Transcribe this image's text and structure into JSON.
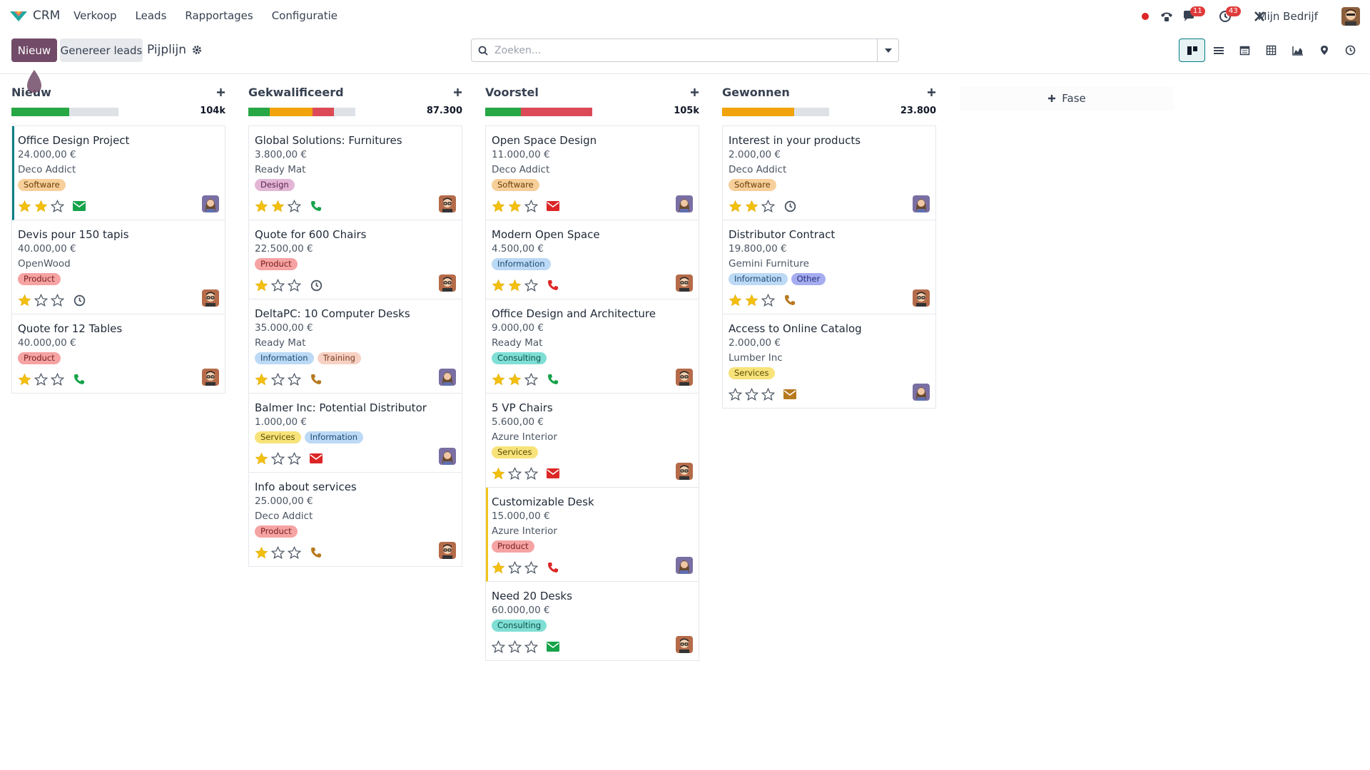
{
  "nav": {
    "app_name": "CRM",
    "menu": [
      "Verkoop",
      "Leads",
      "Rapportages",
      "Configuratie"
    ],
    "messages_badge": "11",
    "activities_badge": "43",
    "company": "Mijn Bedrijf"
  },
  "control": {
    "new_label": "Nieuw",
    "generate_label": "Genereer leads",
    "breadcrumb": "Pijplijn",
    "search_placeholder": "Zoeken...",
    "views": [
      "kanban",
      "list",
      "calendar",
      "pivot",
      "graph",
      "map",
      "activity"
    ],
    "active_view": "kanban"
  },
  "add_stage_label": "Fase",
  "colors": {
    "primary": "#714b67",
    "green": "#28a745",
    "orange": "#f0a30a",
    "red": "#dc4a58",
    "grey": "#dee2e6",
    "teal": "#017e84"
  },
  "columns": [
    {
      "title": "Nieuw",
      "total": "104k",
      "progress": [
        {
          "color": "#28a745",
          "pct": 54
        },
        {
          "color": "#dee2e6",
          "pct": 46
        }
      ],
      "cards": [
        {
          "title": "Office Design Project",
          "amount": "24.000,00 €",
          "company": "Deco Addict",
          "tags": [
            {
              "label": "Software",
              "bg": "#f7cf9a",
              "fg": "#6b3d06"
            }
          ],
          "stars": 2,
          "activity": "email",
          "activity_color": "#16a34a",
          "avatar": "woman",
          "highlight": "#017e84"
        },
        {
          "title": "Devis pour 150 tapis",
          "amount": "40.000,00 €",
          "company": "OpenWood",
          "tags": [
            {
              "label": "Product",
              "bg": "#f5a3a3",
              "fg": "#7a1f1f"
            }
          ],
          "stars": 1,
          "activity": "clock",
          "activity_color": "#4b5563",
          "avatar": "man"
        },
        {
          "title": "Quote for 12 Tables",
          "amount": "40.000,00 €",
          "company": "",
          "tags": [
            {
              "label": "Product",
              "bg": "#f5a3a3",
              "fg": "#7a1f1f"
            }
          ],
          "stars": 1,
          "activity": "phone",
          "activity_color": "#16a34a",
          "avatar": "man"
        }
      ]
    },
    {
      "title": "Gekwalificeerd",
      "total": "87.300",
      "progress": [
        {
          "color": "#28a745",
          "pct": 20
        },
        {
          "color": "#f0a30a",
          "pct": 40
        },
        {
          "color": "#dc4a58",
          "pct": 20
        },
        {
          "color": "#dee2e6",
          "pct": 20
        }
      ],
      "cards": [
        {
          "title": "Global Solutions: Furnitures",
          "amount": "3.800,00 €",
          "company": "Ready Mat",
          "tags": [
            {
              "label": "Design",
              "bg": "#e3b6d6",
              "fg": "#5a2450"
            }
          ],
          "stars": 2,
          "activity": "phone",
          "activity_color": "#16a34a",
          "avatar": "man"
        },
        {
          "title": "Quote for 600 Chairs",
          "amount": "22.500,00 €",
          "company": "",
          "tags": [
            {
              "label": "Product",
              "bg": "#f5a3a3",
              "fg": "#7a1f1f"
            }
          ],
          "stars": 1,
          "activity": "clock",
          "activity_color": "#4b5563",
          "avatar": "man"
        },
        {
          "title": "DeltaPC: 10 Computer Desks",
          "amount": "35.000,00 €",
          "company": "Ready Mat",
          "tags": [
            {
              "label": "Information",
              "bg": "#bcd9f5",
              "fg": "#1f4b75"
            },
            {
              "label": "Training",
              "bg": "#f7d2c4",
              "fg": "#7a3a1f"
            }
          ],
          "stars": 1,
          "activity": "phone",
          "activity_color": "#b7791f",
          "avatar": "woman"
        },
        {
          "title": "Balmer Inc: Potential Distributor",
          "amount": "1.000,00 €",
          "company": "",
          "tags": [
            {
              "label": "Services",
              "bg": "#f7e37a",
              "fg": "#5c4b05"
            },
            {
              "label": "Information",
              "bg": "#bcd9f5",
              "fg": "#1f4b75"
            }
          ],
          "stars": 1,
          "activity": "email",
          "activity_color": "#dc2626",
          "avatar": "woman"
        },
        {
          "title": "Info about services",
          "amount": "25.000,00 €",
          "company": "Deco Addict",
          "tags": [
            {
              "label": "Product",
              "bg": "#f5a3a3",
              "fg": "#7a1f1f"
            }
          ],
          "stars": 1,
          "activity": "phone",
          "activity_color": "#b7791f",
          "avatar": "man"
        }
      ]
    },
    {
      "title": "Voorstel",
      "total": "105k",
      "progress": [
        {
          "color": "#28a745",
          "pct": 33
        },
        {
          "color": "#dc4a58",
          "pct": 67
        }
      ],
      "cards": [
        {
          "title": "Open Space Design",
          "amount": "11.000,00 €",
          "company": "Deco Addict",
          "tags": [
            {
              "label": "Software",
              "bg": "#f7cf9a",
              "fg": "#6b3d06"
            }
          ],
          "stars": 2,
          "activity": "email",
          "activity_color": "#dc2626",
          "avatar": "woman"
        },
        {
          "title": "Modern Open Space",
          "amount": "4.500,00 €",
          "company": "",
          "tags": [
            {
              "label": "Information",
              "bg": "#bcd9f5",
              "fg": "#1f4b75"
            }
          ],
          "stars": 2,
          "activity": "phone",
          "activity_color": "#dc2626",
          "avatar": "man"
        },
        {
          "title": "Office Design and Architecture",
          "amount": "9.000,00 €",
          "company": "Ready Mat",
          "tags": [
            {
              "label": "Consulting",
              "bg": "#7fdfd4",
              "fg": "#0b4f48"
            }
          ],
          "stars": 2,
          "activity": "phone",
          "activity_color": "#16a34a",
          "avatar": "man"
        },
        {
          "title": "5 VP Chairs",
          "amount": "5.600,00 €",
          "company": "Azure Interior",
          "tags": [
            {
              "label": "Services",
              "bg": "#f7e37a",
              "fg": "#5c4b05"
            }
          ],
          "stars": 1,
          "activity": "email",
          "activity_color": "#dc2626",
          "avatar": "man"
        },
        {
          "title": "Customizable Desk",
          "amount": "15.000,00 €",
          "company": "Azure Interior",
          "tags": [
            {
              "label": "Product",
              "bg": "#f5a3a3",
              "fg": "#7a1f1f"
            }
          ],
          "stars": 1,
          "activity": "phone",
          "activity_color": "#dc2626",
          "avatar": "woman",
          "highlight": "#f0c419"
        },
        {
          "title": "Need 20 Desks",
          "amount": "60.000,00 €",
          "company": "",
          "tags": [
            {
              "label": "Consulting",
              "bg": "#7fdfd4",
              "fg": "#0b4f48"
            }
          ],
          "stars": 0,
          "activity": "email",
          "activity_color": "#16a34a",
          "avatar": "man"
        }
      ]
    },
    {
      "title": "Gewonnen",
      "total": "23.800",
      "progress": [
        {
          "color": "#f0a30a",
          "pct": 67
        },
        {
          "color": "#dee2e6",
          "pct": 33
        }
      ],
      "cards": [
        {
          "title": "Interest in your products",
          "amount": "2.000,00 €",
          "company": "Deco Addict",
          "tags": [
            {
              "label": "Software",
              "bg": "#f7cf9a",
              "fg": "#6b3d06"
            }
          ],
          "stars": 2,
          "activity": "clock",
          "activity_color": "#4b5563",
          "avatar": "woman"
        },
        {
          "title": "Distributor Contract",
          "amount": "19.800,00 €",
          "company": "Gemini Furniture",
          "tags": [
            {
              "label": "Information",
              "bg": "#bcd9f5",
              "fg": "#1f4b75"
            },
            {
              "label": "Other",
              "bg": "#a5acf0",
              "fg": "#2a2f7a"
            }
          ],
          "stars": 2,
          "activity": "phone",
          "activity_color": "#b7791f",
          "avatar": "man"
        },
        {
          "title": "Access to Online Catalog",
          "amount": "2.000,00 €",
          "company": "Lumber Inc",
          "tags": [
            {
              "label": "Services",
              "bg": "#f7e37a",
              "fg": "#5c4b05"
            }
          ],
          "stars": 0,
          "activity": "email",
          "activity_color": "#b7791f",
          "avatar": "woman"
        }
      ]
    }
  ]
}
